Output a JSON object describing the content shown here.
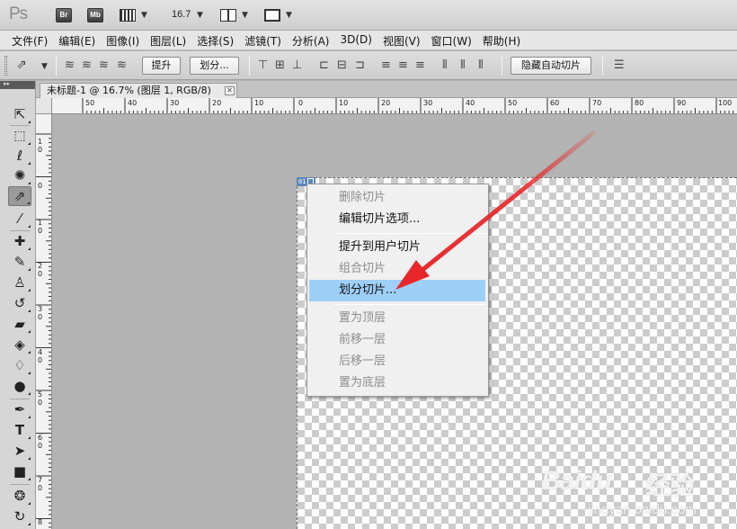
{
  "app": {
    "logo": "Ps",
    "bridge_btn": "Br",
    "minibridge_btn": "Mb",
    "zoom_value": "16.7"
  },
  "menubar": [
    "文件(F)",
    "编辑(E)",
    "图像(I)",
    "图层(L)",
    "选择(S)",
    "滤镜(T)",
    "分析(A)",
    "3D(D)",
    "视图(V)",
    "窗口(W)",
    "帮助(H)"
  ],
  "options": {
    "promote_btn": "提升",
    "divide_btn": "划分...",
    "hide_auto_slices_btn": "隐藏自动切片"
  },
  "document": {
    "tab_title": "未标题-1 @ 16.7% (图层 1, RGB/8)",
    "slice_number": "01"
  },
  "ruler": {
    "h_labels": [
      "50",
      "40",
      "30",
      "20",
      "10",
      "0",
      "10",
      "20",
      "30",
      "40",
      "50",
      "60",
      "70",
      "80",
      "90",
      "100"
    ],
    "v_labels": [
      "1\n0",
      "0",
      "1\n0",
      "2\n0",
      "3\n0",
      "4\n0",
      "5\n0",
      "6\n0",
      "7\n0",
      "8"
    ]
  },
  "context_menu": {
    "items": [
      {
        "label": "删除切片",
        "enabled": false
      },
      {
        "label": "编辑切片选项...",
        "enabled": true
      },
      {
        "separator": true
      },
      {
        "label": "提升到用户切片",
        "enabled": true
      },
      {
        "label": "组合切片",
        "enabled": false
      },
      {
        "label": "划分切片...",
        "enabled": true,
        "highlighted": true
      },
      {
        "separator": true
      },
      {
        "label": "置为顶层",
        "enabled": false
      },
      {
        "label": "前移一层",
        "enabled": false
      },
      {
        "label": "后移一层",
        "enabled": false
      },
      {
        "label": "置为底层",
        "enabled": false
      }
    ]
  },
  "watermark": {
    "brand": "Baidu",
    "brand_cn": "经验",
    "url": "jingyan.baidu.com"
  },
  "colors": {
    "highlight": "#9ecff7",
    "arrow": "#e8272b",
    "slice_badge": "#5e86b8"
  }
}
